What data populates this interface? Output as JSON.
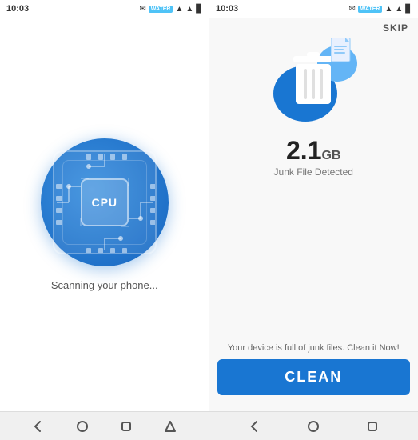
{
  "statusBar": {
    "left": {
      "time": "10:03",
      "waterBadge": "WATER",
      "icons": [
        "msg-icon",
        "wifi-icon",
        "signal-icon",
        "battery-icon"
      ]
    },
    "right": {
      "time": "10:03",
      "waterBadge": "WATER",
      "icons": [
        "msg-icon",
        "wifi-icon",
        "signal-icon",
        "battery-icon"
      ]
    }
  },
  "skipButton": "SKIP",
  "cpuSection": {
    "label": "CPU",
    "scanningText": "Scanning your phone..."
  },
  "junkSection": {
    "size": "2.1",
    "unit": "GB",
    "detectedLabel": "Junk File Detected",
    "warningText": "Your device is full of junk files. Clean it Now!",
    "cleanButton": "CLEAN"
  },
  "navBar": {
    "leftItems": [
      "back-icon",
      "home-icon",
      "recent-icon",
      "menu-icon"
    ],
    "rightItems": [
      "back-icon",
      "home-icon",
      "recent-icon"
    ]
  }
}
